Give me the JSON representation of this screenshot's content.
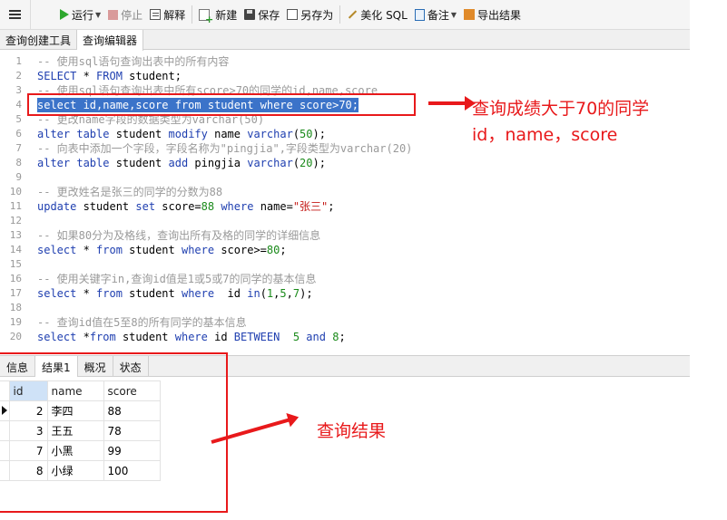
{
  "toolbar": {
    "run_label": "运行",
    "stop_label": "停止",
    "explain_label": "解释",
    "new_label": "新建",
    "save_label": "保存",
    "saveas_label": "另存为",
    "beautify_label": "美化 SQL",
    "note_label": "备注",
    "export_label": "导出结果"
  },
  "tabs": [
    {
      "label": "查询创建工具"
    },
    {
      "label": "查询编辑器"
    }
  ],
  "editor": {
    "line_numbers": [
      "1",
      "2",
      "3",
      "4",
      "5",
      "6",
      "7",
      "8",
      "9",
      "10",
      "11",
      "12",
      "13",
      "14",
      "15",
      "16",
      "17",
      "18",
      "19",
      "20"
    ],
    "l1": "-- 使用sql语句查询出表中的所有内容",
    "l2a": "SELECT",
    "l2b": " * ",
    "l2c": "FROM",
    "l2d": " student;",
    "l3": "-- 使用sql语句查询出表中所有score>70的同学的id,name,score",
    "l4": "select id,name,score from student where score>70;",
    "l5": "-- 更改name字段的数据类型为varchar(50)",
    "l6a": "alter table",
    "l6b": " student ",
    "l6c": "modify",
    "l6d": " name ",
    "l6e": "varchar",
    "l6f": "(",
    "l6g": "50",
    "l6h": ");",
    "l7": "-- 向表中添加一个字段，字段名称为\"pingjia\",字段类型为varchar(20)",
    "l8a": "alter table",
    "l8b": " student ",
    "l8c": "add",
    "l8d": " pingjia ",
    "l8e": "varchar",
    "l8f": "(",
    "l8g": "20",
    "l8h": ");",
    "l10": "-- 更改姓名是张三的同学的分数为88",
    "l11a": "update",
    "l11b": " student ",
    "l11c": "set",
    "l11d": " score=",
    "l11e": "88",
    "l11f": " where",
    "l11g": " name=",
    "l11h": "\"张三\"",
    "l11i": ";",
    "l13": "-- 如果80分为及格线，查询出所有及格的同学的详细信息",
    "l14a": "select",
    "l14b": " * ",
    "l14c": "from",
    "l14d": " student ",
    "l14e": "where",
    "l14f": " score>=",
    "l14g": "80",
    "l14h": ";",
    "l16": "-- 使用关键字in,查询id值是1或5或7的同学的基本信息",
    "l17a": "select",
    "l17b": " * ",
    "l17c": "from",
    "l17d": " student ",
    "l17e": "where",
    "l17f": "  id ",
    "l17g": "in",
    "l17h": "(",
    "l17i": "1",
    "l17j": ",",
    "l17k": "5",
    "l17l": ",",
    "l17m": "7",
    "l17n": ");",
    "l19": "-- 查询id值在5至8的所有同学的基本信息",
    "l20a": "select",
    "l20b": " *",
    "l20c": "from",
    "l20d": " student ",
    "l20e": "where",
    "l20f": " id ",
    "l20g": "BETWEEN",
    "l20h": "  ",
    "l20i": "5",
    "l20j": " ",
    "l20k": "and",
    "l20l": " ",
    "l20m": "8",
    "l20n": ";"
  },
  "annotations": {
    "query_note_line1": "查询成绩大于70的同学",
    "query_note_line2": "id，name，score",
    "result_note": "查询结果"
  },
  "result_tabs": [
    {
      "label": "信息"
    },
    {
      "label": "结果1"
    },
    {
      "label": "概况"
    },
    {
      "label": "状态"
    }
  ],
  "result": {
    "columns": [
      "id",
      "name",
      "score"
    ],
    "rows": [
      {
        "id": "2",
        "name": "李四",
        "score": "88"
      },
      {
        "id": "3",
        "name": "王五",
        "score": "78"
      },
      {
        "id": "7",
        "name": "小黑",
        "score": "99"
      },
      {
        "id": "8",
        "name": "小绿",
        "score": "100"
      }
    ]
  },
  "colors": {
    "annotation_red": "#e8191b",
    "selection_blue": "#3b73c9",
    "keyword_blue": "#1f3fb0",
    "comment_gray": "#9a9a9a"
  }
}
